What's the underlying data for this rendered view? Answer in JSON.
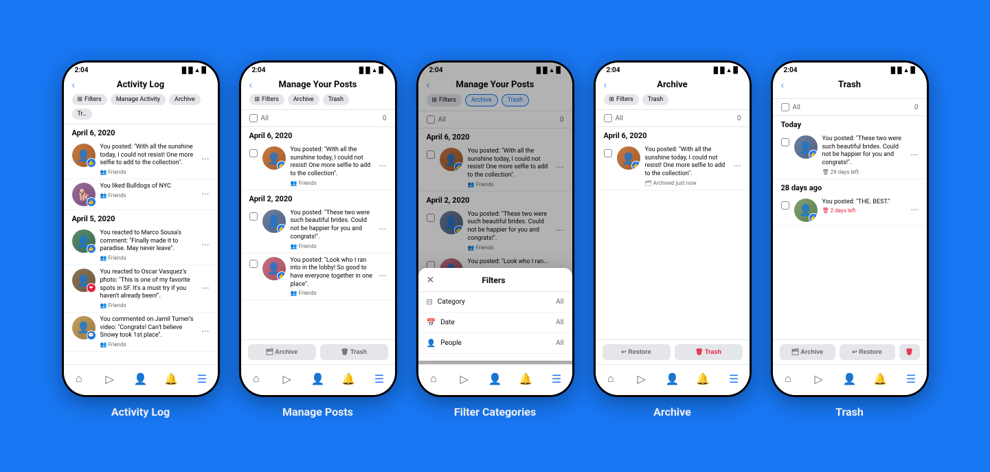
{
  "page": {
    "background": "#1877F2"
  },
  "phones": [
    {
      "id": "activity-log",
      "label": "Activity Log",
      "time": "2:04",
      "screen_title": "Activity Log",
      "chips": [
        {
          "label": "Filters",
          "icon": "⊞",
          "type": "filter"
        },
        {
          "label": "Manage Activity",
          "type": "normal"
        },
        {
          "label": "Archive",
          "type": "normal"
        },
        {
          "label": "Tr…",
          "type": "normal"
        }
      ],
      "sections": [
        {
          "date": "April 6, 2020",
          "items": [
            {
              "text": "You posted: \"With all the sunshine today, I could not resist! One more selfie to add to the collection\".",
              "meta": "Friends",
              "avatar_class": "av1",
              "badge_color": "#1877F2",
              "badge_icon": "👍"
            }
          ]
        },
        {
          "date": "",
          "items": [
            {
              "text": "You liked Bulldogs of NYC",
              "meta": "Friends",
              "avatar_class": "av2",
              "badge_color": "#1877F2",
              "badge_icon": "👍"
            }
          ]
        },
        {
          "date": "April 5, 2020",
          "items": [
            {
              "text": "You reacted to Marco Sousa's comment: \"Finally made it to paradise. May never leave\".",
              "meta": "Friends",
              "avatar_class": "av3",
              "badge_color": "#1877F2",
              "badge_icon": "👍"
            },
            {
              "text": "You reacted to Oscar Vasquez's photo: \"This is one of my favorite spots in SF. It's a must try if you haven't already been!\".",
              "meta": "Friends",
              "avatar_class": "av4",
              "badge_color": "#e41e3f",
              "badge_icon": "❤"
            },
            {
              "text": "You commented on Jamil Turner's video: \"Congrats! Can't believe Snowy took 1st place\".",
              "meta": "Friends",
              "avatar_class": "av5",
              "badge_color": "#1877F2",
              "badge_icon": "💬"
            }
          ]
        }
      ]
    },
    {
      "id": "manage-posts",
      "label": "Manage Posts",
      "time": "2:04",
      "screen_title": "Manage Your Posts",
      "chips": [
        {
          "label": "Filters",
          "icon": "⊞",
          "type": "filter"
        },
        {
          "label": "Archive",
          "type": "normal"
        },
        {
          "label": "Trash",
          "type": "normal"
        }
      ],
      "select_all_count": 0,
      "sections": [
        {
          "date": "April 6, 2020",
          "items": [
            {
              "text": "You posted: \"With all the sunshine today, I could not resist! One more selfie to add to the collection\".",
              "meta": "Friends",
              "avatar_class": "av1",
              "badge_color": "#1877F2",
              "badge_icon": "👍",
              "has_checkbox": true
            }
          ]
        },
        {
          "date": "April 2, 2020",
          "items": [
            {
              "text": "You posted: \"These two were such beautiful brides. Could not be happier for you and congrats!\".",
              "meta": "Friends",
              "avatar_class": "av6",
              "badge_color": "#1877F2",
              "badge_icon": "👍",
              "has_checkbox": true
            },
            {
              "text": "You posted: \"Look who I ran into in the lobby! So good to have everyone together in one place\".",
              "meta": "Friends",
              "avatar_class": "av7",
              "badge_color": "#1877F2",
              "badge_icon": "👍",
              "has_checkbox": true
            }
          ]
        }
      ],
      "action_bar": [
        {
          "label": "Archive",
          "icon": "🗂",
          "type": "normal"
        },
        {
          "label": "Trash",
          "icon": "🗑",
          "type": "normal"
        }
      ]
    },
    {
      "id": "filter-categories",
      "label": "Filter Categories",
      "time": "2:04",
      "screen_title": "Manage Your Posts",
      "chips": [
        {
          "label": "Filters",
          "icon": "⊞",
          "type": "filter"
        },
        {
          "label": "Archive",
          "type": "active"
        },
        {
          "label": "Trash",
          "type": "active"
        }
      ],
      "select_all_count": 0,
      "sections": [
        {
          "date": "April 6, 2020",
          "items": [
            {
              "text": "You posted: \"With all the sunshine today, I could not resist! One more selfie to add to the collection\".",
              "meta": "Friends",
              "avatar_class": "av1",
              "badge_color": "#1877F2",
              "badge_icon": "👍",
              "has_checkbox": true
            }
          ]
        },
        {
          "date": "April 2, 2020",
          "items": [
            {
              "text": "You posted: \"These two were such beautiful brides. Could not be happier for you and congrats!\".",
              "meta": "Friends",
              "avatar_class": "av6",
              "badge_color": "#1877F2",
              "badge_icon": "👍",
              "has_checkbox": true
            },
            {
              "text": "You posted: \"Look who I ran…",
              "meta": "Friends",
              "avatar_class": "av7",
              "badge_color": "#1877F2",
              "badge_icon": "👍",
              "has_checkbox": true
            }
          ]
        }
      ],
      "has_overlay": true,
      "modal": {
        "title": "Filters",
        "rows": [
          {
            "icon": "⊟",
            "label": "Category",
            "value": "All"
          },
          {
            "icon": "📅",
            "label": "Date",
            "value": "All"
          },
          {
            "icon": "👤",
            "label": "People",
            "value": "All"
          }
        ]
      }
    },
    {
      "id": "archive",
      "label": "Archive",
      "time": "2:04",
      "screen_title": "Archive",
      "chips": [
        {
          "label": "Filters",
          "icon": "⊞",
          "type": "filter"
        },
        {
          "label": "Trash",
          "type": "normal"
        }
      ],
      "select_all_count": 0,
      "sections": [
        {
          "date": "April 6, 2020",
          "items": [
            {
              "text": "You posted: \"With all the sunshine today, I could not resist! One more selfie to add to the collection\".",
              "meta": "Archived just now",
              "avatar_class": "av1",
              "badge_color": "#1877F2",
              "badge_icon": "👍",
              "has_checkbox": true,
              "status_type": "archived"
            }
          ]
        }
      ],
      "action_bar": [
        {
          "label": "Restore",
          "icon": "↩",
          "type": "normal"
        },
        {
          "label": "Trash",
          "icon": "🗑",
          "type": "danger"
        }
      ]
    },
    {
      "id": "trash",
      "label": "Trash",
      "time": "2:04",
      "screen_title": "Trash",
      "chips": [],
      "select_all_count": 0,
      "sections_special": true,
      "today_section": {
        "date": "Today",
        "items": [
          {
            "text": "You posted: \"These two were such beautiful brides. Could not be happier for you and congrats!\".",
            "meta": "29 days left",
            "avatar_class": "av6",
            "badge_color": "#1877F2",
            "badge_icon": "👍",
            "has_checkbox": true,
            "status_type": "trash_grey"
          }
        ]
      },
      "daysago_section": {
        "date": "28 days ago",
        "items": [
          {
            "text": "You posted: \"THE. BEST.\"",
            "meta": "2 days left",
            "avatar_class": "av8",
            "badge_color": "#1877F2",
            "badge_icon": "👍",
            "has_checkbox": true,
            "status_type": "trash_red"
          }
        ]
      },
      "action_bar": [
        {
          "label": "Archive",
          "icon": "🗂",
          "type": "normal"
        },
        {
          "label": "Restore",
          "icon": "↩",
          "type": "normal"
        },
        {
          "label": "",
          "icon": "🗑",
          "type": "danger icon-only"
        }
      ]
    }
  ]
}
